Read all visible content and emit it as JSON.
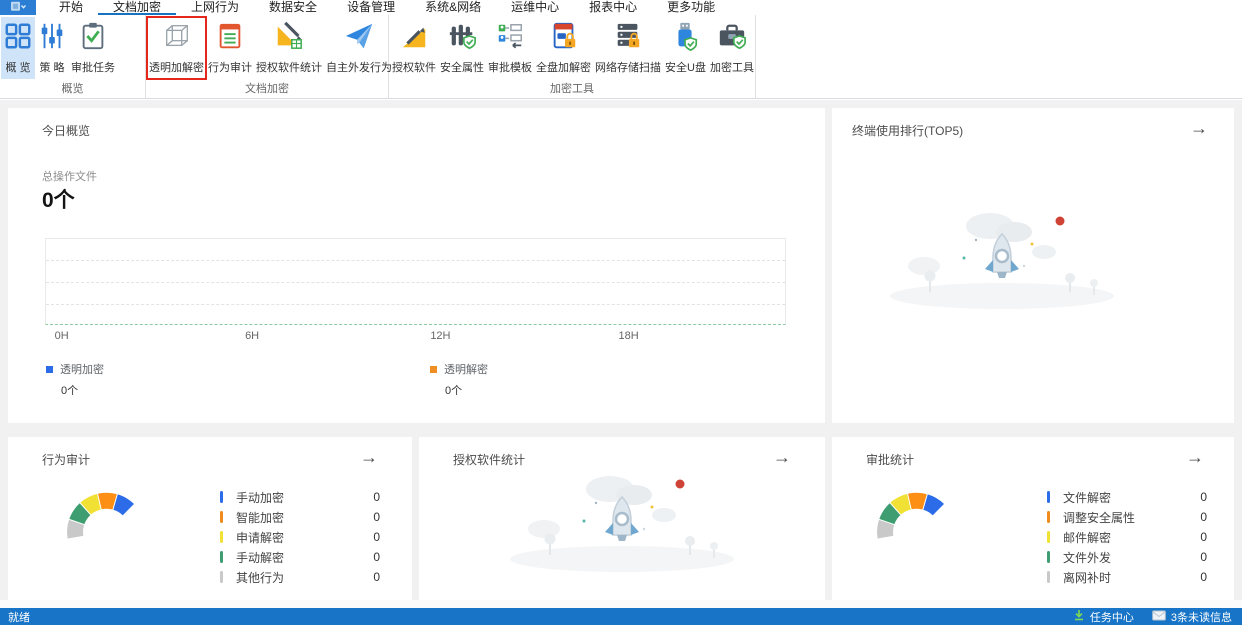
{
  "menu": {
    "app_button": {
      "icon": "app-menu-icon"
    },
    "tabs": [
      {
        "label": "开始",
        "active": false
      },
      {
        "label": "文档加密",
        "active": true
      },
      {
        "label": "上网行为",
        "active": false
      },
      {
        "label": "数据安全",
        "active": false
      },
      {
        "label": "设备管理",
        "active": false
      },
      {
        "label": "系统&网络",
        "active": false
      },
      {
        "label": "运维中心",
        "active": false
      },
      {
        "label": "报表中心",
        "active": false
      },
      {
        "label": "更多功能",
        "active": false
      }
    ]
  },
  "ribbon": {
    "groups": [
      {
        "label": "概览",
        "buttons": [
          {
            "label": "概 览",
            "icon": "grid-icon",
            "selected": true
          },
          {
            "label": "策 略",
            "icon": "sliders-icon"
          },
          {
            "label": "审批任务",
            "icon": "clipboard-check-icon"
          }
        ]
      },
      {
        "label": "文档加密",
        "buttons": [
          {
            "label": "透明加解密",
            "icon": "cube-icon",
            "highlighted": true
          },
          {
            "label": "行为审计",
            "icon": "audit-list-icon"
          },
          {
            "label": "授权软件统计",
            "icon": "software-stats-icon"
          },
          {
            "label": "自主外发行为",
            "icon": "paper-plane-icon"
          }
        ]
      },
      {
        "label": "加密工具",
        "buttons": [
          {
            "label": "授权软件",
            "icon": "ruler-pencil-icon"
          },
          {
            "label": "安全属性",
            "icon": "fence-shield-icon"
          },
          {
            "label": "审批模板",
            "icon": "approval-template-icon"
          },
          {
            "label": "全盘加解密",
            "icon": "ssd-lock-icon"
          },
          {
            "label": "网络存储扫描",
            "icon": "server-lock-icon"
          },
          {
            "label": "安全U盘",
            "icon": "usb-shield-icon"
          },
          {
            "label": "加密工具",
            "icon": "toolbox-shield-icon"
          }
        ]
      }
    ]
  },
  "cards": {
    "today": {
      "title": "今日概览",
      "metric_label": "总操作文件",
      "metric_value": "0个",
      "chart": {
        "x_ticks": [
          "0H",
          "6H",
          "12H",
          "18H"
        ]
      },
      "legend": [
        {
          "label": "透明加密",
          "value": "0个",
          "color": "#2d6ce8"
        },
        {
          "label": "透明解密",
          "value": "0个",
          "color": "#ef8f23"
        }
      ]
    },
    "terminal_rank": {
      "title": "终端使用排行(TOP5)",
      "arrow": "→"
    },
    "behavior_audit": {
      "title": "行为审计",
      "arrow": "→",
      "items": [
        {
          "label": "手动加密",
          "value": "0",
          "color": "#2d6ce8"
        },
        {
          "label": "智能加密",
          "value": "0",
          "color": "#f08c1e"
        },
        {
          "label": "申请解密",
          "value": "0",
          "color": "#f2e135"
        },
        {
          "label": "手动解密",
          "value": "0",
          "color": "#3f9e71"
        },
        {
          "label": "其他行为",
          "value": "0",
          "color": "#c9c9c9"
        }
      ]
    },
    "licensed_software": {
      "title": "授权软件统计",
      "arrow": "→"
    },
    "approval_stats": {
      "title": "审批统计",
      "arrow": "→",
      "items": [
        {
          "label": "文件解密",
          "value": "0",
          "color": "#2d6ce8"
        },
        {
          "label": "调整安全属性",
          "value": "0",
          "color": "#f08c1e"
        },
        {
          "label": "邮件解密",
          "value": "0",
          "color": "#f2e135"
        },
        {
          "label": "文件外发",
          "value": "0",
          "color": "#3f9e71"
        },
        {
          "label": "离网补时",
          "value": "0",
          "color": "#c9c9c9"
        }
      ]
    }
  },
  "status_bar": {
    "ready": "就绪",
    "task_center": "任务中心",
    "unread": "3条未读信息"
  },
  "colors": {
    "accent_blue": "#1673c1",
    "statusbar_bg": "#1774c6",
    "selected_tile_bg": "#cfe4f8",
    "highlight_red": "#e5271b",
    "chart_baseline_green": "#8cc9a0"
  },
  "chart_data": [
    {
      "type": "line",
      "title": "今日概览",
      "x_ticks": [
        "0H",
        "6H",
        "12H",
        "18H"
      ],
      "series": [
        {
          "name": "透明加密",
          "total": "0个",
          "color": "#2d6ce8",
          "values": []
        },
        {
          "name": "透明解密",
          "total": "0个",
          "color": "#ef8f23",
          "values": []
        }
      ],
      "grid": "dashed-horizontal",
      "note": "empty chart, no data points"
    },
    {
      "type": "gauge",
      "title": "行为审计",
      "segments": [
        "#c9c9c9",
        "#3f9e71",
        "#f2e135",
        "#f08c1e",
        "#2d6ce8"
      ],
      "items": [
        {
          "label": "手动加密",
          "value": 0
        },
        {
          "label": "智能加密",
          "value": 0
        },
        {
          "label": "申请解密",
          "value": 0
        },
        {
          "label": "手动解密",
          "value": 0
        },
        {
          "label": "其他行为",
          "value": 0
        }
      ]
    },
    {
      "type": "gauge",
      "title": "审批统计",
      "segments": [
        "#c9c9c9",
        "#3f9e71",
        "#f2e135",
        "#f08c1e",
        "#2d6ce8"
      ],
      "items": [
        {
          "label": "文件解密",
          "value": 0
        },
        {
          "label": "调整安全属性",
          "value": 0
        },
        {
          "label": "邮件解密",
          "value": 0
        },
        {
          "label": "文件外发",
          "value": 0
        },
        {
          "label": "离网补时",
          "value": 0
        }
      ]
    }
  ]
}
